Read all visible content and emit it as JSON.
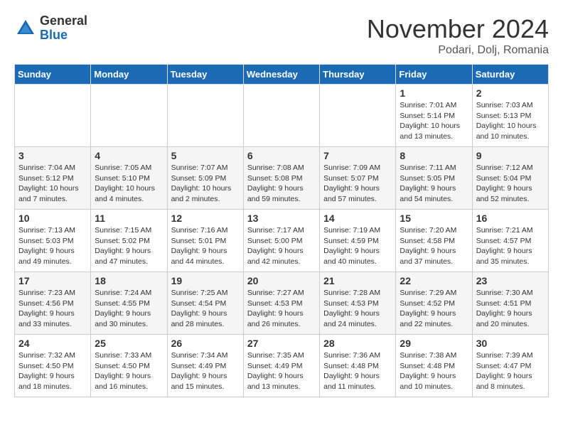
{
  "logo": {
    "general": "General",
    "blue": "Blue"
  },
  "title": "November 2024",
  "location": "Podari, Dolj, Romania",
  "days_header": [
    "Sunday",
    "Monday",
    "Tuesday",
    "Wednesday",
    "Thursday",
    "Friday",
    "Saturday"
  ],
  "weeks": [
    {
      "row_class": "row-white",
      "days": [
        {
          "num": "",
          "info": "",
          "empty": true
        },
        {
          "num": "",
          "info": "",
          "empty": true
        },
        {
          "num": "",
          "info": "",
          "empty": true
        },
        {
          "num": "",
          "info": "",
          "empty": true
        },
        {
          "num": "",
          "info": "",
          "empty": true
        },
        {
          "num": "1",
          "info": "Sunrise: 7:01 AM\nSunset: 5:14 PM\nDaylight: 10 hours\nand 13 minutes.",
          "empty": false
        },
        {
          "num": "2",
          "info": "Sunrise: 7:03 AM\nSunset: 5:13 PM\nDaylight: 10 hours\nand 10 minutes.",
          "empty": false
        }
      ]
    },
    {
      "row_class": "row-gray",
      "days": [
        {
          "num": "3",
          "info": "Sunrise: 7:04 AM\nSunset: 5:12 PM\nDaylight: 10 hours\nand 7 minutes.",
          "empty": false
        },
        {
          "num": "4",
          "info": "Sunrise: 7:05 AM\nSunset: 5:10 PM\nDaylight: 10 hours\nand 4 minutes.",
          "empty": false
        },
        {
          "num": "5",
          "info": "Sunrise: 7:07 AM\nSunset: 5:09 PM\nDaylight: 10 hours\nand 2 minutes.",
          "empty": false
        },
        {
          "num": "6",
          "info": "Sunrise: 7:08 AM\nSunset: 5:08 PM\nDaylight: 9 hours\nand 59 minutes.",
          "empty": false
        },
        {
          "num": "7",
          "info": "Sunrise: 7:09 AM\nSunset: 5:07 PM\nDaylight: 9 hours\nand 57 minutes.",
          "empty": false
        },
        {
          "num": "8",
          "info": "Sunrise: 7:11 AM\nSunset: 5:05 PM\nDaylight: 9 hours\nand 54 minutes.",
          "empty": false
        },
        {
          "num": "9",
          "info": "Sunrise: 7:12 AM\nSunset: 5:04 PM\nDaylight: 9 hours\nand 52 minutes.",
          "empty": false
        }
      ]
    },
    {
      "row_class": "row-white",
      "days": [
        {
          "num": "10",
          "info": "Sunrise: 7:13 AM\nSunset: 5:03 PM\nDaylight: 9 hours\nand 49 minutes.",
          "empty": false
        },
        {
          "num": "11",
          "info": "Sunrise: 7:15 AM\nSunset: 5:02 PM\nDaylight: 9 hours\nand 47 minutes.",
          "empty": false
        },
        {
          "num": "12",
          "info": "Sunrise: 7:16 AM\nSunset: 5:01 PM\nDaylight: 9 hours\nand 44 minutes.",
          "empty": false
        },
        {
          "num": "13",
          "info": "Sunrise: 7:17 AM\nSunset: 5:00 PM\nDaylight: 9 hours\nand 42 minutes.",
          "empty": false
        },
        {
          "num": "14",
          "info": "Sunrise: 7:19 AM\nSunset: 4:59 PM\nDaylight: 9 hours\nand 40 minutes.",
          "empty": false
        },
        {
          "num": "15",
          "info": "Sunrise: 7:20 AM\nSunset: 4:58 PM\nDaylight: 9 hours\nand 37 minutes.",
          "empty": false
        },
        {
          "num": "16",
          "info": "Sunrise: 7:21 AM\nSunset: 4:57 PM\nDaylight: 9 hours\nand 35 minutes.",
          "empty": false
        }
      ]
    },
    {
      "row_class": "row-gray",
      "days": [
        {
          "num": "17",
          "info": "Sunrise: 7:23 AM\nSunset: 4:56 PM\nDaylight: 9 hours\nand 33 minutes.",
          "empty": false
        },
        {
          "num": "18",
          "info": "Sunrise: 7:24 AM\nSunset: 4:55 PM\nDaylight: 9 hours\nand 30 minutes.",
          "empty": false
        },
        {
          "num": "19",
          "info": "Sunrise: 7:25 AM\nSunset: 4:54 PM\nDaylight: 9 hours\nand 28 minutes.",
          "empty": false
        },
        {
          "num": "20",
          "info": "Sunrise: 7:27 AM\nSunset: 4:53 PM\nDaylight: 9 hours\nand 26 minutes.",
          "empty": false
        },
        {
          "num": "21",
          "info": "Sunrise: 7:28 AM\nSunset: 4:53 PM\nDaylight: 9 hours\nand 24 minutes.",
          "empty": false
        },
        {
          "num": "22",
          "info": "Sunrise: 7:29 AM\nSunset: 4:52 PM\nDaylight: 9 hours\nand 22 minutes.",
          "empty": false
        },
        {
          "num": "23",
          "info": "Sunrise: 7:30 AM\nSunset: 4:51 PM\nDaylight: 9 hours\nand 20 minutes.",
          "empty": false
        }
      ]
    },
    {
      "row_class": "row-white",
      "days": [
        {
          "num": "24",
          "info": "Sunrise: 7:32 AM\nSunset: 4:50 PM\nDaylight: 9 hours\nand 18 minutes.",
          "empty": false
        },
        {
          "num": "25",
          "info": "Sunrise: 7:33 AM\nSunset: 4:50 PM\nDaylight: 9 hours\nand 16 minutes.",
          "empty": false
        },
        {
          "num": "26",
          "info": "Sunrise: 7:34 AM\nSunset: 4:49 PM\nDaylight: 9 hours\nand 15 minutes.",
          "empty": false
        },
        {
          "num": "27",
          "info": "Sunrise: 7:35 AM\nSunset: 4:49 PM\nDaylight: 9 hours\nand 13 minutes.",
          "empty": false
        },
        {
          "num": "28",
          "info": "Sunrise: 7:36 AM\nSunset: 4:48 PM\nDaylight: 9 hours\nand 11 minutes.",
          "empty": false
        },
        {
          "num": "29",
          "info": "Sunrise: 7:38 AM\nSunset: 4:48 PM\nDaylight: 9 hours\nand 10 minutes.",
          "empty": false
        },
        {
          "num": "30",
          "info": "Sunrise: 7:39 AM\nSunset: 4:47 PM\nDaylight: 9 hours\nand 8 minutes.",
          "empty": false
        }
      ]
    }
  ]
}
